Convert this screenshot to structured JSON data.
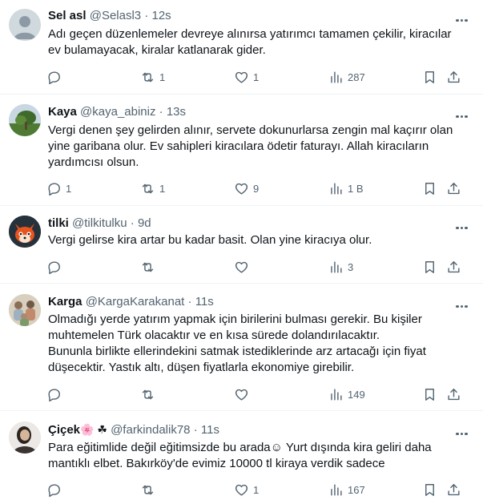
{
  "tweets": [
    {
      "name": "Sel asl",
      "handle": "@Selasl3",
      "sep": "·",
      "time": "12s",
      "lines": [
        "Adı geçen düzenlemeler devreye alınırsa yatırımcı tamamen çekilir, kiracılar",
        "ev bulamayacak, kiralar katlanarak gider."
      ],
      "replies": "",
      "retweets": "1",
      "likes": "1",
      "views": "287",
      "avatar": "default-avatar"
    },
    {
      "name": "Kaya",
      "handle": "@kaya_abiniz",
      "sep": "·",
      "time": "13s",
      "lines": [
        "Vergi denen şey gelirden alınır, servete dokunurlarsa zengin mal kaçırır olan",
        "yine garibana olur. Ev sahipleri kiracılara ödetir faturayı. Allah kiracıların",
        "yardımcısı olsun."
      ],
      "replies": "1",
      "retweets": "1",
      "likes": "9",
      "views": "1 B",
      "avatar": "tree-photo"
    },
    {
      "name": "tilki",
      "handle": "@tilkitulku",
      "sep": "·",
      "time": "9d",
      "lines": [
        "Vergi gelirse kira artar bu kadar basit. Olan yine kiracıya olur."
      ],
      "replies": "",
      "retweets": "",
      "likes": "",
      "views": "3",
      "avatar": "fox-avatar"
    },
    {
      "name": "Karga",
      "handle": "@KargaKarakanat",
      "sep": "·",
      "time": "11s",
      "lines": [
        "Olmadığı yerde yatırım yapmak için birilerini bulması gerekir. Bu kişiler",
        "muhtemelen Türk olacaktır ve en kısa sürede dolandırılacaktır.",
        "Bununla birlikte ellerindekini satmak istediklerinde arz artacağı için fiyat",
        "düşecektir. Yastık altı, düşen fiyatlarla ekonomiye girebilir."
      ],
      "replies": "",
      "retweets": "",
      "likes": "",
      "views": "149",
      "avatar": "group-photo"
    },
    {
      "name": "Çiçek",
      "name_emoji": "🌸 ☘",
      "handle": "@farkindalik78",
      "sep": "·",
      "time": "11s",
      "lines": [
        "Para eğitimlide değil eğitimsizde bu arada☺ Yurt dışında kira geliri daha",
        "mantıklı elbet. Bakırköy'de evimiz 10000 tl kiraya verdik sadece"
      ],
      "replies": "",
      "retweets": "",
      "likes": "1",
      "views": "167",
      "avatar": "person-photo"
    }
  ],
  "colors": {
    "text": "#0f1419",
    "secondary": "#536471",
    "divider": "#eff3f4"
  }
}
